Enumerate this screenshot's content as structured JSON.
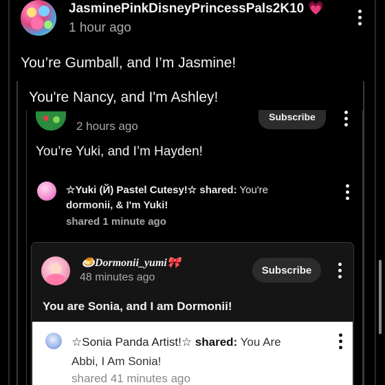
{
  "post": {
    "author": "JasminePinkDisneyPrincessPals2K10",
    "heart": "💗",
    "time": "1 hour ago",
    "text": "You’re Gumball, and I’m Jasmine!"
  },
  "nested1": {
    "text": "You're Nancy, and I'm Ashley!"
  },
  "nested2": {
    "subscribe_label": "Subscribe",
    "time": "2 hours ago",
    "text": "You’re Yuki, and I’m Hayden!"
  },
  "share_yuki": {
    "author": "☆Yuki (Й) Pastel Cutesy!☆",
    "shared_word": " shared:",
    "text_line1": " You're",
    "text_line2": "dormonii, & I'm Yuki!",
    "time": "shared 1 minute ago"
  },
  "dormonii": {
    "author": "🍮Dormonii_yumi🎀",
    "time": "48 minutes ago",
    "subscribe_label": "Subscribe",
    "text": "You are Sonia, and I am Dormonii!"
  },
  "share_sonia": {
    "author": "☆Sonia Panda Artist!☆",
    "shared_word": " shared:",
    "text_line1": " You Are",
    "text_line2": "Abbi, I Am Sonia!",
    "time": "shared 41 minutes ago"
  }
}
